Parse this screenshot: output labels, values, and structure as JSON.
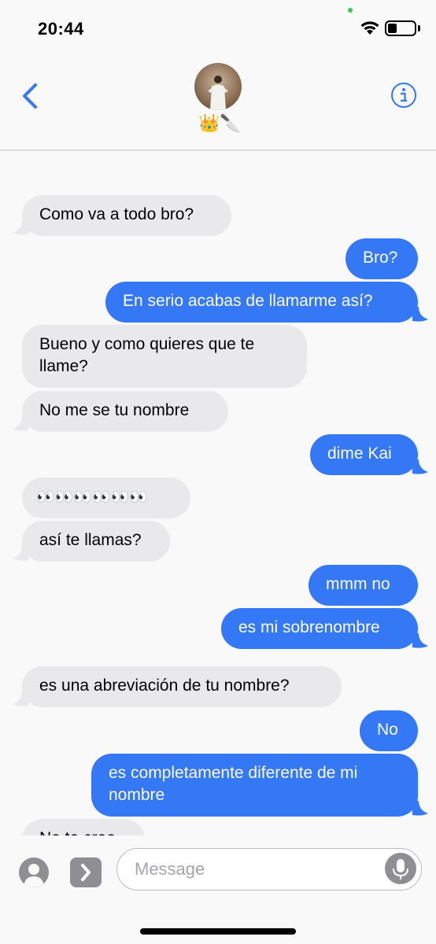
{
  "status_bar": {
    "time": "20:44",
    "battery_level": 0.35
  },
  "header": {
    "contact_emoji": "👑🔪",
    "back_icon": "chevron-left-icon",
    "info_icon": "info-circle-icon",
    "accent_color": "#3478f6"
  },
  "messages": [
    {
      "side": "in",
      "text": "Como va a todo bro?"
    },
    {
      "side": "out",
      "text": "Bro?"
    },
    {
      "side": "out",
      "text": "En serio acabas de llamarme así?"
    },
    {
      "side": "in",
      "text": "Bueno y como quieres que te\nllame?"
    },
    {
      "side": "in",
      "text": "No me se tu nombre"
    },
    {
      "side": "out",
      "text": "dime Kai"
    },
    {
      "side": "in",
      "text": "👀👀👀👀👀👀"
    },
    {
      "side": "in",
      "text": "así te llamas?"
    },
    {
      "side": "out",
      "text": "mmm no"
    },
    {
      "side": "out",
      "text": "es mi sobrenombre"
    },
    {
      "side": "in",
      "text": "es una abreviación de tu nombre?"
    },
    {
      "side": "out",
      "text": "No"
    },
    {
      "side": "out",
      "text": "es completamente diferente de mi\nnombre"
    },
    {
      "side": "in",
      "text": "No te creo"
    }
  ],
  "input_bar": {
    "placeholder": "Message",
    "value": "",
    "camera_icon": "camera-icon",
    "apps_icon": "app-store-icon",
    "mic_icon": "microphone-icon"
  },
  "colors": {
    "incoming_bubble": "#e9e9eb",
    "outgoing_bubble": "#3478f6"
  }
}
